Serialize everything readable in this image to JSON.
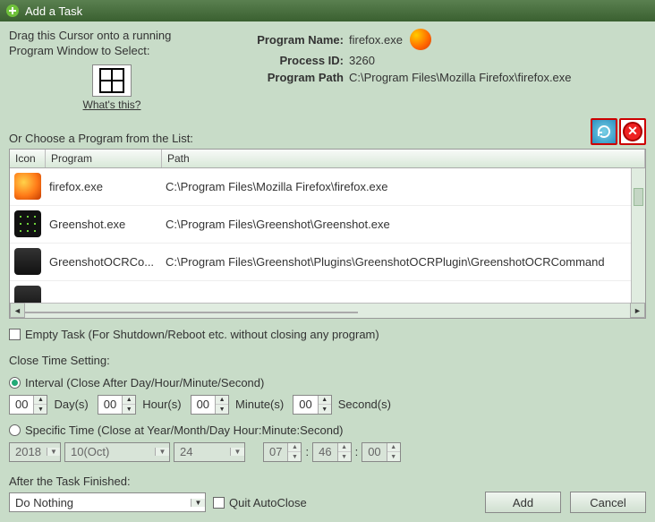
{
  "window": {
    "title": "Add a Task"
  },
  "drag": {
    "text": "Drag this Cursor onto a running Program Window to Select:",
    "whatsThis": "What's this?"
  },
  "info": {
    "nameLabel": "Program Name:",
    "nameValue": "firefox.exe",
    "pidLabel": "Process ID:",
    "pidValue": "3260",
    "pathLabel": "Program Path",
    "pathValue": "C:\\Program Files\\Mozilla Firefox\\firefox.exe"
  },
  "list": {
    "chooseLabel": "Or Choose a Program from the List:",
    "headers": {
      "icon": "Icon",
      "program": "Program",
      "path": "Path"
    },
    "rows": [
      {
        "iconClass": "pi-ff",
        "program": "firefox.exe",
        "path": "C:\\Program Files\\Mozilla Firefox\\firefox.exe"
      },
      {
        "iconClass": "pi-gs",
        "program": "Greenshot.exe",
        "path": "C:\\Program Files\\Greenshot\\Greenshot.exe"
      },
      {
        "iconClass": "pi-cmd",
        "program": "GreenshotOCRCo...",
        "path": "C:\\Program Files\\Greenshot\\Plugins\\GreenshotOCRPlugin\\GreenshotOCRCommand"
      },
      {
        "iconClass": "pi-cmd",
        "program": "",
        "path": ""
      }
    ]
  },
  "emptyTask": {
    "label": "Empty Task (For Shutdown/Reboot etc. without closing any program)"
  },
  "closeTime": {
    "heading": "Close Time Setting:",
    "intervalLabel": "Interval (Close After Day/Hour/Minute/Second)",
    "specificLabel": "Specific Time (Close at Year/Month/Day Hour:Minute:Second)",
    "days": "00",
    "daysUnit": "Day(s)",
    "hours": "00",
    "hoursUnit": "Hour(s)",
    "minutes": "00",
    "minutesUnit": "Minute(s)",
    "seconds": "00",
    "secondsUnit": "Second(s)",
    "year": "2018",
    "month": "10(Oct)",
    "day": "24",
    "h": "07",
    "m": "46",
    "s": "00",
    "colon": ":"
  },
  "after": {
    "heading": "After the Task Finished:",
    "action": "Do Nothing",
    "quitLabel": "Quit AutoClose"
  },
  "buttons": {
    "add": "Add",
    "cancel": "Cancel"
  }
}
